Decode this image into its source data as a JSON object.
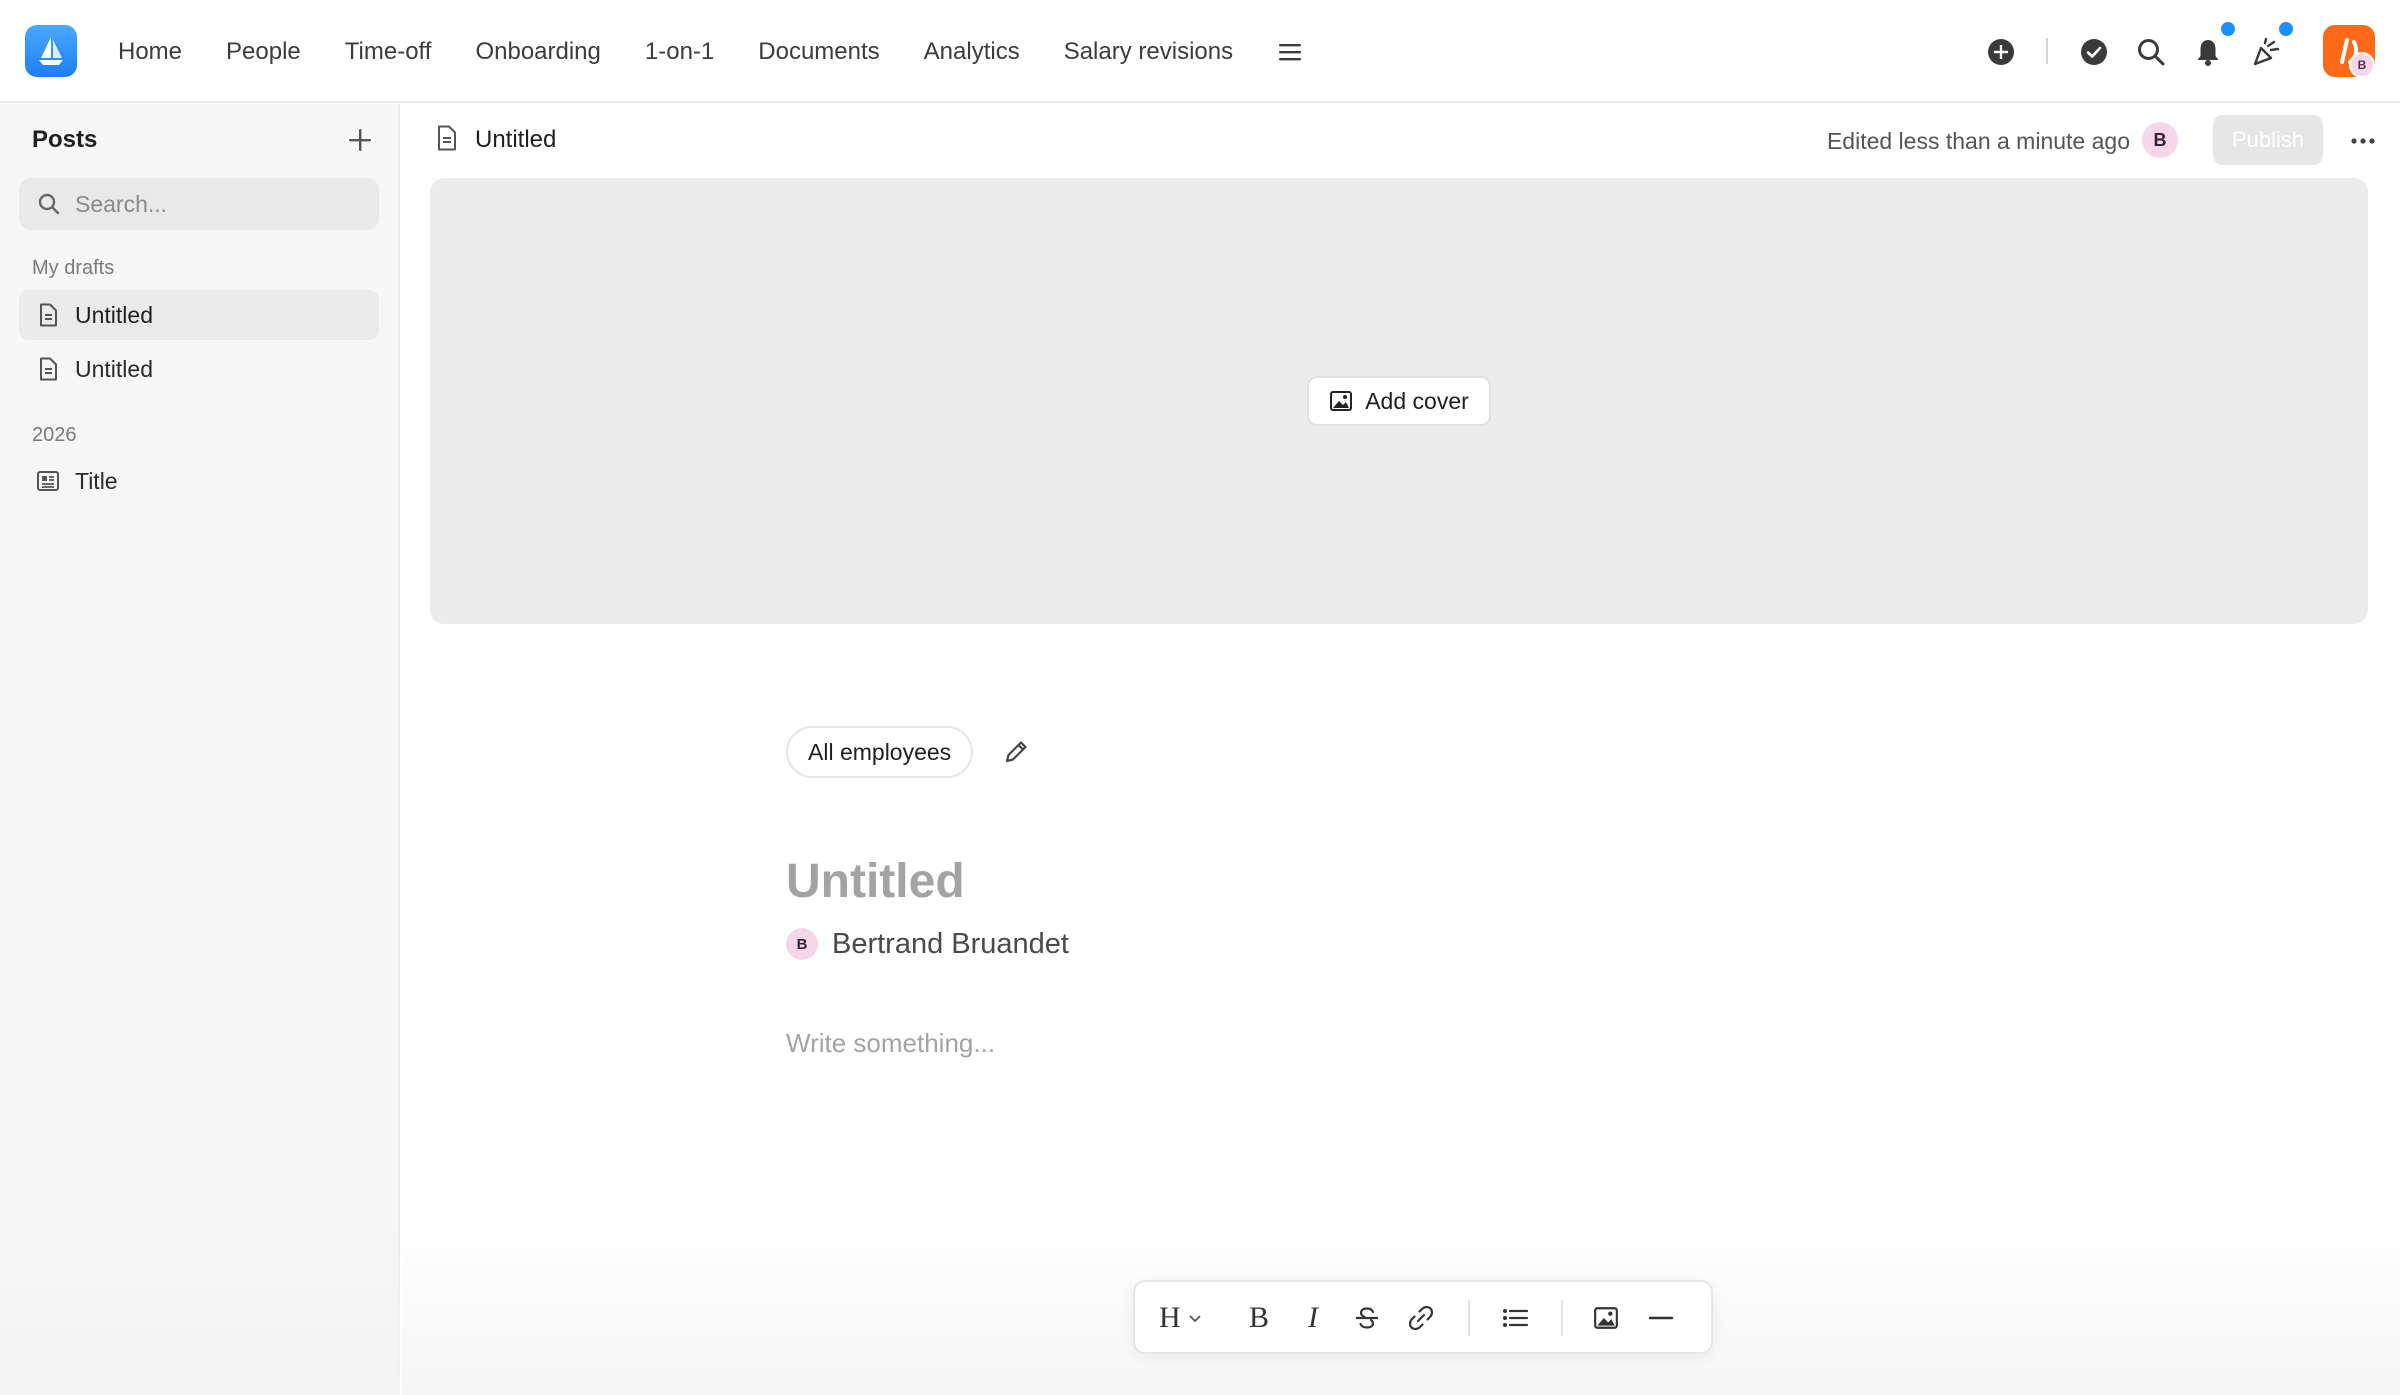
{
  "nav": {
    "items": [
      "Home",
      "People",
      "Time-off",
      "Onboarding",
      "1-on-1",
      "Documents",
      "Analytics",
      "Salary revisions"
    ],
    "menu_icon": "hamburger-icon"
  },
  "top_right": {
    "icons": [
      "plus-circle-icon",
      "check-circle-icon",
      "search-icon",
      "bell-icon",
      "celebration-icon"
    ],
    "avatar_initial": "B",
    "notification_dot_color": "#1e90ff",
    "app_logo_color": "#ff6a1a"
  },
  "sidebar": {
    "title": "Posts",
    "search_placeholder": "Search...",
    "section_drafts": "My drafts",
    "drafts": [
      {
        "label": "Untitled",
        "active": true
      },
      {
        "label": "Untitled",
        "active": false
      }
    ],
    "section_year": "2026",
    "year_items": [
      {
        "label": "Title"
      }
    ]
  },
  "doc": {
    "title": "Untitled",
    "edited": "Edited less than a minute ago",
    "avatar_initial": "B",
    "publish_label": "Publish",
    "add_cover_label": "Add cover",
    "audience": "All employees",
    "post_title_placeholder": "Untitled",
    "author_initial": "B",
    "author_name": "Bertrand Bruandet",
    "body_placeholder": "Write something..."
  },
  "toolbar": {
    "buttons": [
      "heading-icon",
      "bold-icon",
      "italic-icon",
      "strikethrough-icon",
      "link-icon",
      "bullet-list-icon",
      "image-icon",
      "divider-icon"
    ],
    "heading_glyph": "H",
    "bold_glyph": "B",
    "italic_glyph": "I"
  },
  "colors": {
    "brand_blue": "#1e7ef0",
    "accent_orange": "#ff6a1a",
    "avatar_pink": "#f6d7ea"
  }
}
